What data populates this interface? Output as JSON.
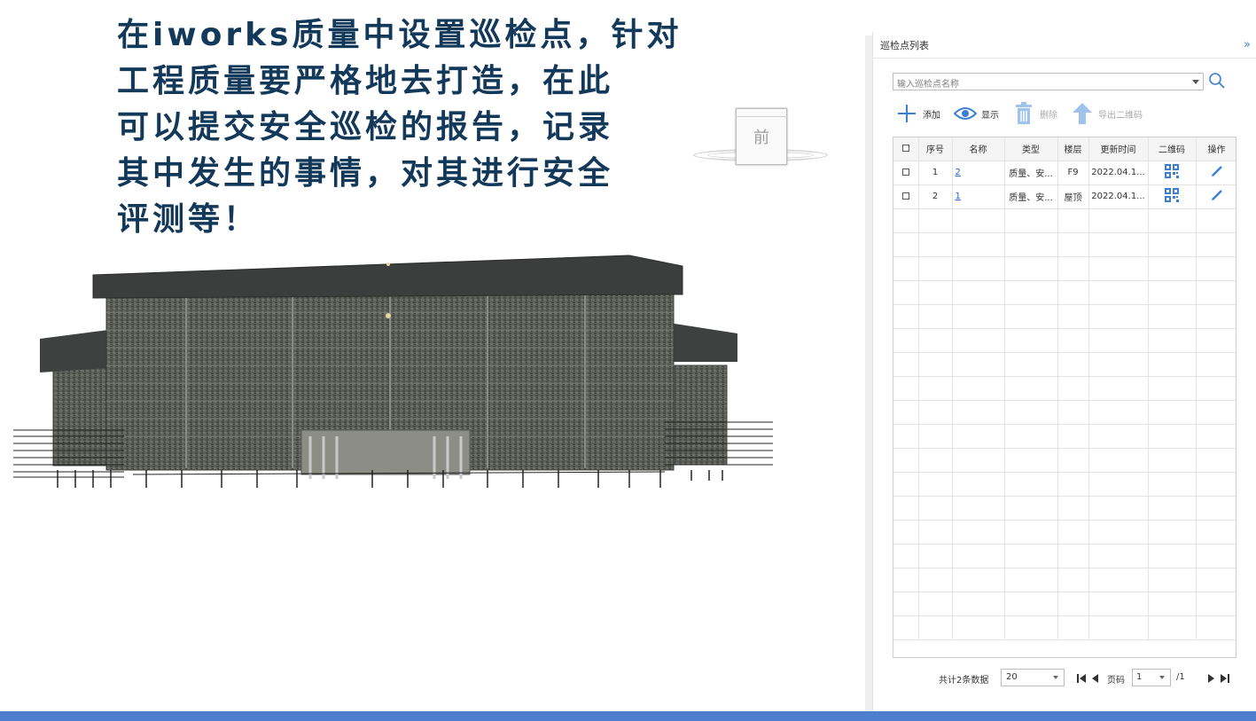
{
  "overlay": {
    "lines": [
      "在iworks质量中设置巡检点，针对",
      "工程质量要严格地去打造，在此",
      "可以提交安全巡检的报告，记录",
      "其中发生的事情，对其进行安全",
      "评测等！"
    ]
  },
  "viewcube": {
    "face_label": "前"
  },
  "panel": {
    "title": "巡检点列表",
    "collapse_glyph": "»",
    "search": {
      "placeholder": "输入巡检点名称",
      "value": ""
    },
    "toolbar": {
      "add_label": "添加",
      "show_label": "显示",
      "delete_label": "删除",
      "export_label": "导出二维码"
    },
    "table": {
      "headers": [
        "序号",
        "名称",
        "类型",
        "楼层",
        "更新时间",
        "二维码",
        "操作"
      ],
      "rows": [
        {
          "index": "1",
          "name": "2",
          "type": "质量、安...",
          "floor": "F9",
          "updated": "2022.04.1..."
        },
        {
          "index": "2",
          "name": "1",
          "type": "质量、安...",
          "floor": "屋顶",
          "updated": "2022.04.1..."
        }
      ]
    },
    "pager": {
      "total_text": "共计2条数据",
      "page_size": "20",
      "page_label": "页码",
      "current_page": "1",
      "total_pages": "/1"
    }
  },
  "colors": {
    "heading": "#12385a",
    "accent": "#3b7fd4",
    "link": "#2a62c8",
    "bottom_bar": "#4e7fce"
  }
}
